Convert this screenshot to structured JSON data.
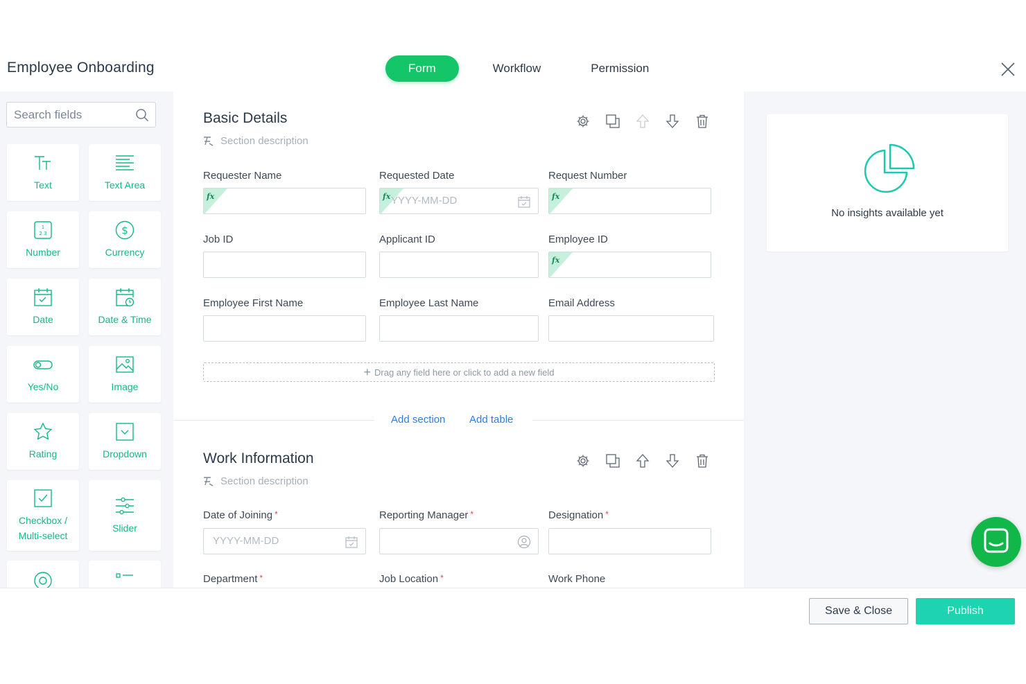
{
  "header": {
    "title": "Employee Onboarding",
    "tabs": [
      {
        "label": "Form",
        "active": true
      },
      {
        "label": "Workflow",
        "active": false
      },
      {
        "label": "Permission",
        "active": false
      }
    ]
  },
  "sidebar": {
    "search_placeholder": "Search fields",
    "tiles": [
      {
        "label": "Text",
        "icon": "text-icon"
      },
      {
        "label": "Text Area",
        "icon": "text-area-icon"
      },
      {
        "label": "Number",
        "icon": "number-icon"
      },
      {
        "label": "Currency",
        "icon": "currency-icon"
      },
      {
        "label": "Date",
        "icon": "date-icon"
      },
      {
        "label": "Date & Time",
        "icon": "date-time-icon"
      },
      {
        "label": "Yes/No",
        "icon": "toggle-icon"
      },
      {
        "label": "Image",
        "icon": "image-icon"
      },
      {
        "label": "Rating",
        "icon": "star-icon"
      },
      {
        "label": "Dropdown",
        "icon": "dropdown-icon"
      },
      {
        "label": "Checkbox / Multi-select",
        "line1": "Checkbox /",
        "line2": "Multi-select",
        "icon": "checkbox-icon"
      },
      {
        "label": "Slider",
        "icon": "slider-icon"
      }
    ]
  },
  "sections": [
    {
      "title": "Basic Details",
      "description_placeholder": "Section description",
      "fields": [
        {
          "label": "Requester Name",
          "formula": true,
          "placeholder": ""
        },
        {
          "label": "Requested Date",
          "formula": true,
          "placeholder": "YYYY-MM-DD"
        },
        {
          "label": "Request Number",
          "formula": true,
          "placeholder": ""
        },
        {
          "label": "Job ID",
          "formula": false,
          "placeholder": ""
        },
        {
          "label": "Applicant ID",
          "formula": false,
          "placeholder": ""
        },
        {
          "label": "Employee ID",
          "formula": true,
          "placeholder": ""
        },
        {
          "label": "Employee First Name",
          "formula": false,
          "placeholder": ""
        },
        {
          "label": "Employee Last Name",
          "formula": false,
          "placeholder": ""
        },
        {
          "label": "Email Address",
          "formula": false,
          "placeholder": ""
        }
      ],
      "dropzone_text": "Drag any field here or click to add a new field"
    },
    {
      "title": "Work Information",
      "description_placeholder": "Section description",
      "fields": [
        {
          "label": "Date of Joining",
          "required": true,
          "placeholder": "YYYY-MM-DD"
        },
        {
          "label": "Reporting Manager",
          "required": true,
          "placeholder": ""
        },
        {
          "label": "Designation",
          "required": true,
          "placeholder": ""
        },
        {
          "label": "Department",
          "required": true
        },
        {
          "label": "Job Location",
          "required": true
        },
        {
          "label": "Work Phone",
          "required": false
        }
      ]
    }
  ],
  "links": {
    "add_section": "Add section",
    "add_table": "Add table"
  },
  "insights": {
    "text": "No insights available yet"
  },
  "footer": {
    "save_close": "Save & Close",
    "publish": "Publish"
  },
  "required_mark": "*",
  "colors": {
    "accent": "#14c56a",
    "tile_text": "#14b885",
    "link": "#2f7de1",
    "publish": "#1dd3b0",
    "chat": "#12b74a"
  }
}
